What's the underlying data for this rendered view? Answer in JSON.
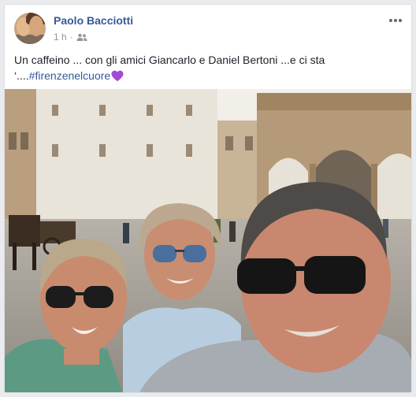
{
  "post": {
    "author": "Paolo Bacciotti",
    "time": "1 h",
    "text_before": "Un caffeino ... con gli amici Giancarlo e Daniel Bertoni ...e ci sta ‘....",
    "hashtag": "#firenzenelcuore",
    "heart_color": "#a24ad6",
    "link_color": "#385898"
  },
  "icons": {
    "audience": "friends-icon",
    "menu": "more-options-icon",
    "emoji": "purple-heart-icon"
  }
}
